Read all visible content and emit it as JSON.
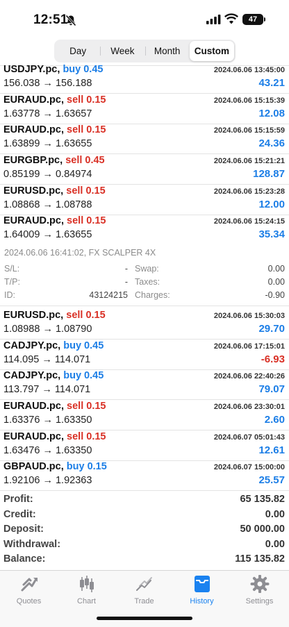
{
  "status_bar": {
    "time": "12:51",
    "battery": "47"
  },
  "period_tabs": [
    {
      "label": "Day",
      "active": false
    },
    {
      "label": "Week",
      "active": false
    },
    {
      "label": "Month",
      "active": false
    },
    {
      "label": "Custom",
      "active": true
    }
  ],
  "deals": [
    {
      "symbol": "USDJPY.pc,",
      "direction": "buy",
      "volume": "buy 0.45",
      "open": "156.038",
      "close": "156.188",
      "datetime": "2024.06.06 13:45:00",
      "profit": "43.21"
    },
    {
      "symbol": "EURAUD.pc,",
      "direction": "sell",
      "volume": "sell 0.15",
      "open": "1.63778",
      "close": "1.63657",
      "datetime": "2024.06.06 15:15:39",
      "profit": "12.08"
    },
    {
      "symbol": "EURAUD.pc,",
      "direction": "sell",
      "volume": "sell 0.15",
      "open": "1.63899",
      "close": "1.63655",
      "datetime": "2024.06.06 15:15:59",
      "profit": "24.36"
    },
    {
      "symbol": "EURGBP.pc,",
      "direction": "sell",
      "volume": "sell 0.45",
      "open": "0.85199",
      "close": "0.84974",
      "datetime": "2024.06.06 15:21:21",
      "profit": "128.87"
    },
    {
      "symbol": "EURUSD.pc,",
      "direction": "sell",
      "volume": "sell 0.15",
      "open": "1.08868",
      "close": "1.08788",
      "datetime": "2024.06.06 15:23:28",
      "profit": "12.00"
    },
    {
      "symbol": "EURAUD.pc,",
      "direction": "sell",
      "volume": "sell 0.15",
      "open": "1.64009",
      "close": "1.63655",
      "datetime": "2024.06.06 15:24:15",
      "profit": "35.34"
    },
    {
      "symbol": "EURUSD.pc,",
      "direction": "sell",
      "volume": "sell 0.15",
      "open": "1.08988",
      "close": "1.08790",
      "datetime": "2024.06.06 15:30:03",
      "profit": "29.70"
    },
    {
      "symbol": "CADJPY.pc,",
      "direction": "buy",
      "volume": "buy 0.45",
      "open": "114.095",
      "close": "114.071",
      "datetime": "2024.06.06 17:15:01",
      "profit": "-6.93"
    },
    {
      "symbol": "CADJPY.pc,",
      "direction": "buy",
      "volume": "buy 0.45",
      "open": "113.797",
      "close": "114.071",
      "datetime": "2024.06.06 22:40:26",
      "profit": "79.07"
    },
    {
      "symbol": "EURAUD.pc,",
      "direction": "sell",
      "volume": "sell 0.15",
      "open": "1.63376",
      "close": "1.63350",
      "datetime": "2024.06.06 23:30:01",
      "profit": "2.60"
    },
    {
      "symbol": "EURAUD.pc,",
      "direction": "sell",
      "volume": "sell 0.15",
      "open": "1.63476",
      "close": "1.63350",
      "datetime": "2024.06.07 05:01:43",
      "profit": "12.61"
    },
    {
      "symbol": "GBPAUD.pc,",
      "direction": "buy",
      "volume": "buy 0.15",
      "open": "1.92106",
      "close": "1.92363",
      "datetime": "2024.06.07 15:00:00",
      "profit": "25.57"
    }
  ],
  "arrow": "→",
  "details": {
    "header": "2024.06.06 16:41:02, FX SCALPER 4X",
    "sl_label": "S/L:",
    "sl_value": "-",
    "tp_label": "T/P:",
    "tp_value": "-",
    "id_label": "ID:",
    "id_value": "43124215",
    "swap_label": "Swap:",
    "swap_value": "0.00",
    "taxes_label": "Taxes:",
    "taxes_value": "0.00",
    "charges_label": "Charges:",
    "charges_value": "-0.90"
  },
  "summary": [
    {
      "label": "Profit:",
      "value": "65 135.82"
    },
    {
      "label": "Credit:",
      "value": "0.00"
    },
    {
      "label": "Deposit:",
      "value": "50 000.00"
    },
    {
      "label": "Withdrawal:",
      "value": "0.00"
    },
    {
      "label": "Balance:",
      "value": "115 135.82"
    }
  ],
  "tabbar": [
    {
      "label": "Quotes",
      "icon": "quotes-icon",
      "active": false
    },
    {
      "label": "Chart",
      "icon": "chart-icon",
      "active": false
    },
    {
      "label": "Trade",
      "icon": "trade-icon",
      "active": false
    },
    {
      "label": "History",
      "icon": "history-icon",
      "active": true
    },
    {
      "label": "Settings",
      "icon": "settings-icon",
      "active": false
    }
  ],
  "colors": {
    "buy": "#1c7ee6",
    "sell": "#d93025",
    "accent": "#1a82f0"
  }
}
